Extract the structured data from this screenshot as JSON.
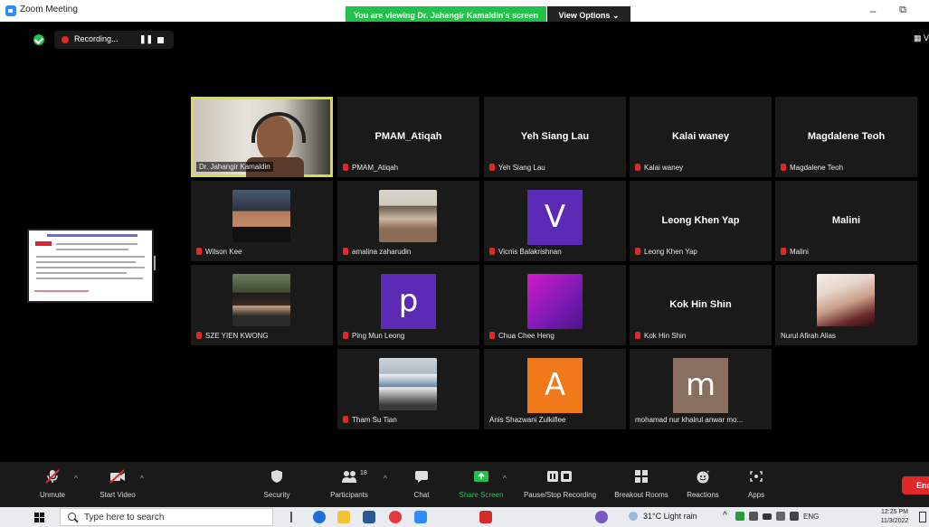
{
  "window": {
    "title": "Zoom Meeting",
    "minimize": "–",
    "restore": "⧉"
  },
  "banner": {
    "text": "You are viewing Dr. Jahangir Kamaldin's screen",
    "view_options": "View Options ⌄"
  },
  "recording": {
    "label": "Recording...",
    "pause": "❚❚"
  },
  "view_button": "▦ V",
  "tiles": {
    "t1": {
      "name": "Dr. Jahangir Kamaldin"
    },
    "t2": {
      "big": "PMAM_Atiqah",
      "name": "PMAM_Atiqah"
    },
    "t3": {
      "big": "Yeh Siang Lau",
      "name": "Yeh Siang Lau"
    },
    "t4": {
      "big": "Kalai waney",
      "name": "Kalai waney"
    },
    "t5": {
      "big": "Magdalene Teoh",
      "name": "Magdalene Teoh"
    },
    "t6": {
      "name": "Wilson Kee"
    },
    "t7": {
      "name": "amalina zaharudin"
    },
    "t8": {
      "avatar": "V",
      "name": "Vicnis Balakrishnan"
    },
    "t9": {
      "big": "Leong Khen Yap",
      "name": "Leong Khen Yap"
    },
    "t10": {
      "big": "Malini",
      "name": "Malini"
    },
    "t11": {
      "name": "SZE YIEN KWONG"
    },
    "t12": {
      "avatar": "p",
      "name": "Ping Mun Leong"
    },
    "t13": {
      "name": "Chua Chee Heng"
    },
    "t14": {
      "big": "Kok Hin Shin",
      "name": "Kok Hin Shin"
    },
    "t15": {
      "name": "Nurul Afirah Alias"
    },
    "t16": {
      "name": "Tham Su Tian"
    },
    "t17": {
      "avatar": "A",
      "name": "Anis Shazwani Zulkiflee"
    },
    "t18": {
      "avatar": "m",
      "name": "mohamad nur khairul anwar mo..."
    }
  },
  "toolbar": {
    "unmute": "Unmute",
    "start_video": "Start Video",
    "security": "Security",
    "participants": "Participants",
    "participants_count": "18",
    "chat": "Chat",
    "share_screen": "Share Screen",
    "pause_recording": "Pause/Stop Recording",
    "breakout": "Breakout Rooms",
    "reactions": "Reactions",
    "apps": "Apps",
    "end": "End"
  },
  "taskbar": {
    "search_placeholder": "Type here to search",
    "weather": "31°C  Light rain",
    "lang": "ENG",
    "time": "12:25 PM",
    "date": "11/3/2022"
  },
  "colors": {
    "accent_green": "#21c14a",
    "end_red": "#e02828",
    "active_border": "#d8dc4b",
    "avatar_v": "#5b2ab5",
    "avatar_p": "#5b2ab5",
    "avatar_a": "#f07a1a",
    "avatar_m": "#8a6e60"
  }
}
